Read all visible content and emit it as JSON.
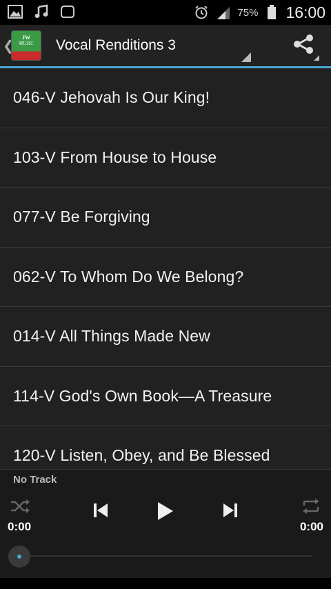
{
  "status_bar": {
    "icons_left": [
      "gallery-icon",
      "music-note-icon",
      "sync-icon"
    ],
    "icons_right": [
      "alarm-icon",
      "signal-icon",
      "battery-icon"
    ],
    "battery_percent": "75%",
    "time": "16:00"
  },
  "action_bar": {
    "logo_text_1": "JW",
    "logo_text_2": "MUSIC",
    "title": "Vocal Renditions 3",
    "accent_color": "#4ca5d4"
  },
  "tracks": [
    "046-V Jehovah Is Our King!",
    "103-V From House to House",
    "077-V Be Forgiving",
    "062-V To Whom Do We Belong?",
    "014-V All Things Made New",
    "114-V God's Own Book—A Treasure",
    "120-V Listen, Obey, and Be Blessed"
  ],
  "player": {
    "now_playing": "No Track",
    "time_elapsed": "0:00",
    "time_total": "0:00",
    "progress": 0
  }
}
